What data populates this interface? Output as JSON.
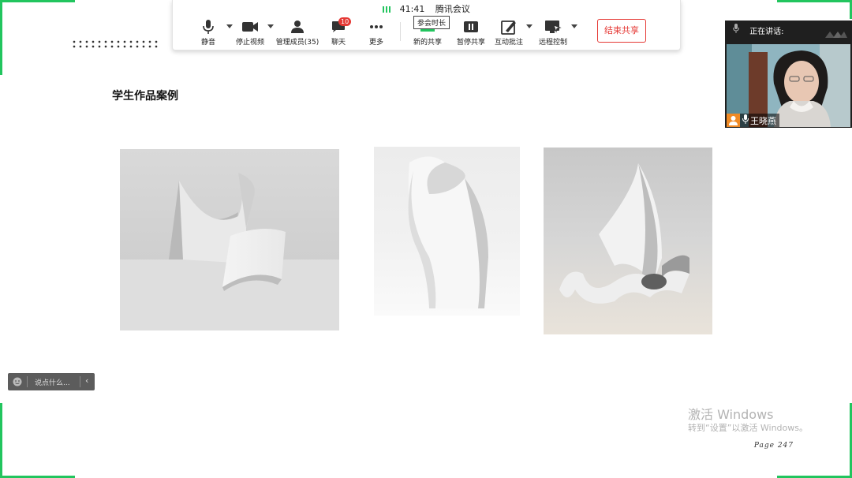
{
  "slide": {
    "title": "学生作品案例",
    "page_label": "Page",
    "page_number": "247"
  },
  "watermark": {
    "line1": "激活 Windows",
    "line2": "转到“设置”以激活 Windows。"
  },
  "toolbar": {
    "time": "41:41",
    "app_name": "腾讯会议",
    "tooltip": "参会时长",
    "mute": "静音",
    "stop_video": "停止视频",
    "manage_members": "管理成员(35)",
    "chat": "聊天",
    "chat_badge": "10",
    "more": "更多",
    "new_share": "新的共享",
    "pause_share": "暂停共享",
    "annotate": "互动批注",
    "remote_control": "远程控制",
    "end_share": "结束共享"
  },
  "speaker": {
    "heading": "正在讲话:",
    "name": "王晓燕"
  },
  "chat_input": {
    "placeholder": "说点什么..."
  },
  "colors": {
    "accent_green": "#22c55e",
    "end_share_red": "#e53935"
  }
}
